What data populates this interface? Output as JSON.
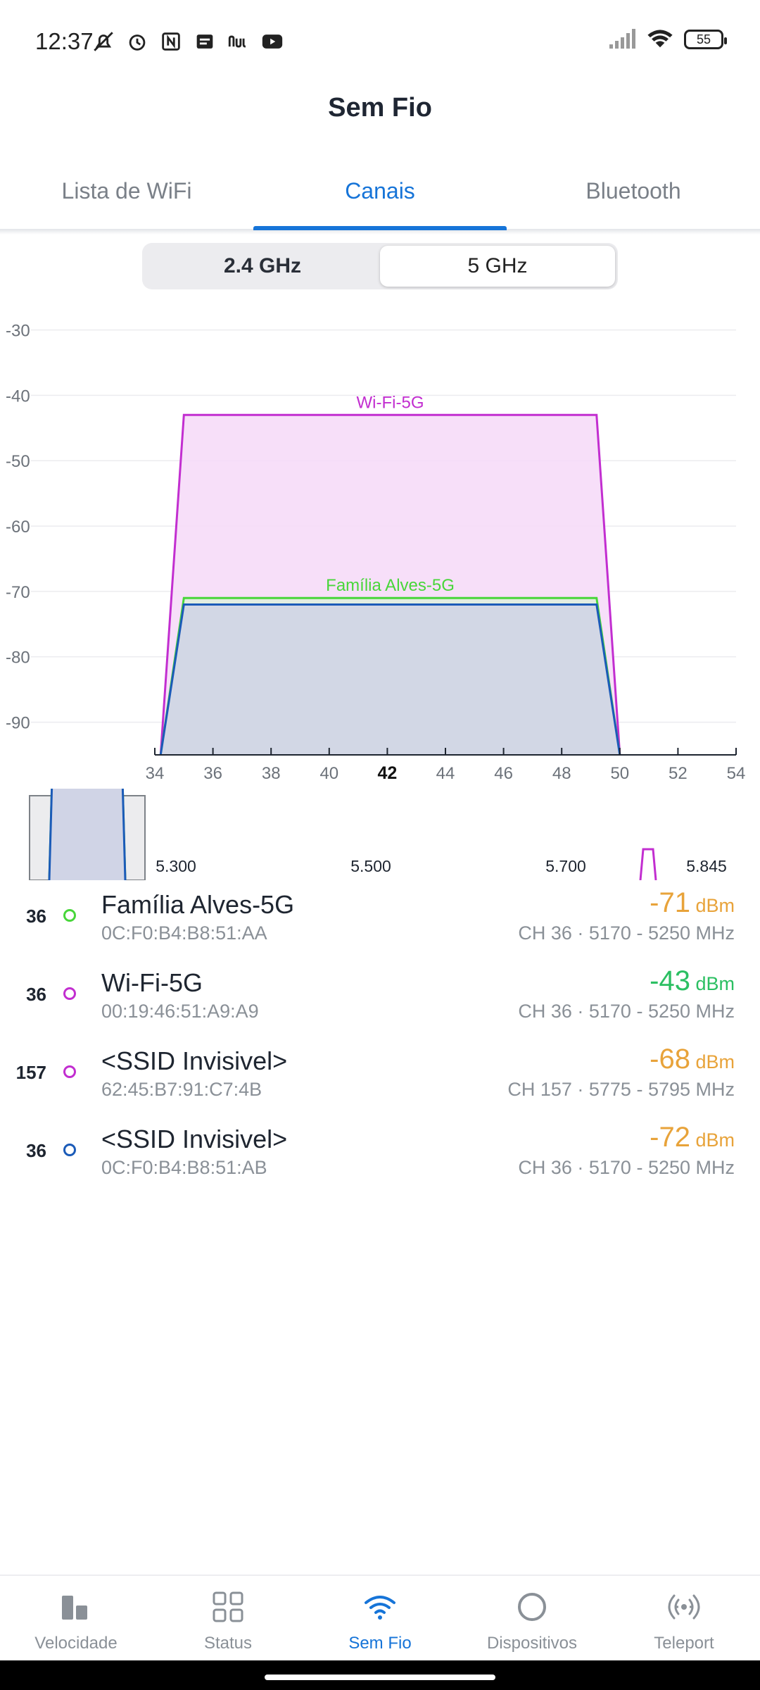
{
  "status_bar": {
    "time": "12:37",
    "left_icons": [
      "mute-bell-icon",
      "alarm-icon",
      "nfc-icon",
      "message-icon",
      "nu-app-icon",
      "youtube-icon"
    ],
    "battery": "55"
  },
  "header": {
    "title": "Sem Fio"
  },
  "tabs": [
    {
      "label": "Lista de WiFi",
      "active": false
    },
    {
      "label": "Canais",
      "active": true
    },
    {
      "label": "Bluetooth",
      "active": false
    }
  ],
  "band": {
    "options": [
      "2.4 GHz",
      "5 GHz"
    ],
    "selected": "5 GHz"
  },
  "chart_data": {
    "type": "area",
    "y_ticks": [
      "-30",
      "-40",
      "-50",
      "-60",
      "-70",
      "-80",
      "-90"
    ],
    "y_range": [
      -95,
      -28
    ],
    "x_ticks": [
      "34",
      "36",
      "38",
      "40",
      "42",
      "44",
      "46",
      "48",
      "50",
      "52",
      "54"
    ],
    "x_range": [
      34,
      54
    ],
    "x_highlight": "42",
    "grid": true,
    "series": [
      {
        "name": "Wi-Fi-5G",
        "channel_start": 34.2,
        "channel_end": 50,
        "flat_start": 35,
        "flat_end": 49.2,
        "signal": -43,
        "color": "#c22ed0",
        "fill": "#f6dcf8",
        "label_shown": true
      },
      {
        "name": "Família Alves-5G",
        "channel_start": 34.2,
        "channel_end": 50,
        "flat_start": 35,
        "flat_end": 49.2,
        "signal": -71,
        "color": "#48d63a",
        "fill": "#dfeedd",
        "label_shown": true
      },
      {
        "name": "<SSID Invisivel>",
        "channel_start": 34.2,
        "channel_end": 50,
        "flat_start": 35,
        "flat_end": 49.2,
        "signal": -72,
        "color": "#1b5bb8",
        "fill": "#d0d4e6",
        "label_shown": false
      }
    ]
  },
  "overview": {
    "freq_labels": [
      "5.300",
      "5.500",
      "5.700",
      "5.845"
    ]
  },
  "networks": [
    {
      "channel": "36",
      "name": "Família Alves-5G",
      "mac": "0C:F0:B4:B8:51:AA",
      "signal": "-71",
      "unit": "dBm",
      "signal_color": "#e8a33a",
      "info": "CH 36 · 5170 - 5250 MHz",
      "dot_color": "#48d63a"
    },
    {
      "channel": "36",
      "name": "Wi-Fi-5G",
      "mac": "00:19:46:51:A9:A9",
      "signal": "-43",
      "unit": "dBm",
      "signal_color": "#2bbf62",
      "info": "CH 36 · 5170 - 5250 MHz",
      "dot_color": "#c22ed0"
    },
    {
      "channel": "157",
      "name": "<SSID Invisivel>",
      "mac": "62:45:B7:91:C7:4B",
      "signal": "-68",
      "unit": "dBm",
      "signal_color": "#e8a33a",
      "info": "CH 157 · 5775 - 5795 MHz",
      "dot_color": "#c22ed0"
    },
    {
      "channel": "36",
      "name": "<SSID Invisivel>",
      "mac": "0C:F0:B4:B8:51:AB",
      "signal": "-72",
      "unit": "dBm",
      "signal_color": "#e8a33a",
      "info": "CH 36 · 5170 - 5250 MHz",
      "dot_color": "#1b5bb8"
    }
  ],
  "bottom_nav": [
    {
      "label": "Velocidade",
      "icon": "speed-bars-icon",
      "active": false
    },
    {
      "label": "Status",
      "icon": "grid-icon",
      "active": false
    },
    {
      "label": "Sem Fio",
      "icon": "wifi-icon",
      "active": true
    },
    {
      "label": "Dispositivos",
      "icon": "circle-icon",
      "active": false
    },
    {
      "label": "Teleport",
      "icon": "teleport-icon",
      "active": false
    }
  ],
  "colors": {
    "accent": "#1674d8"
  }
}
